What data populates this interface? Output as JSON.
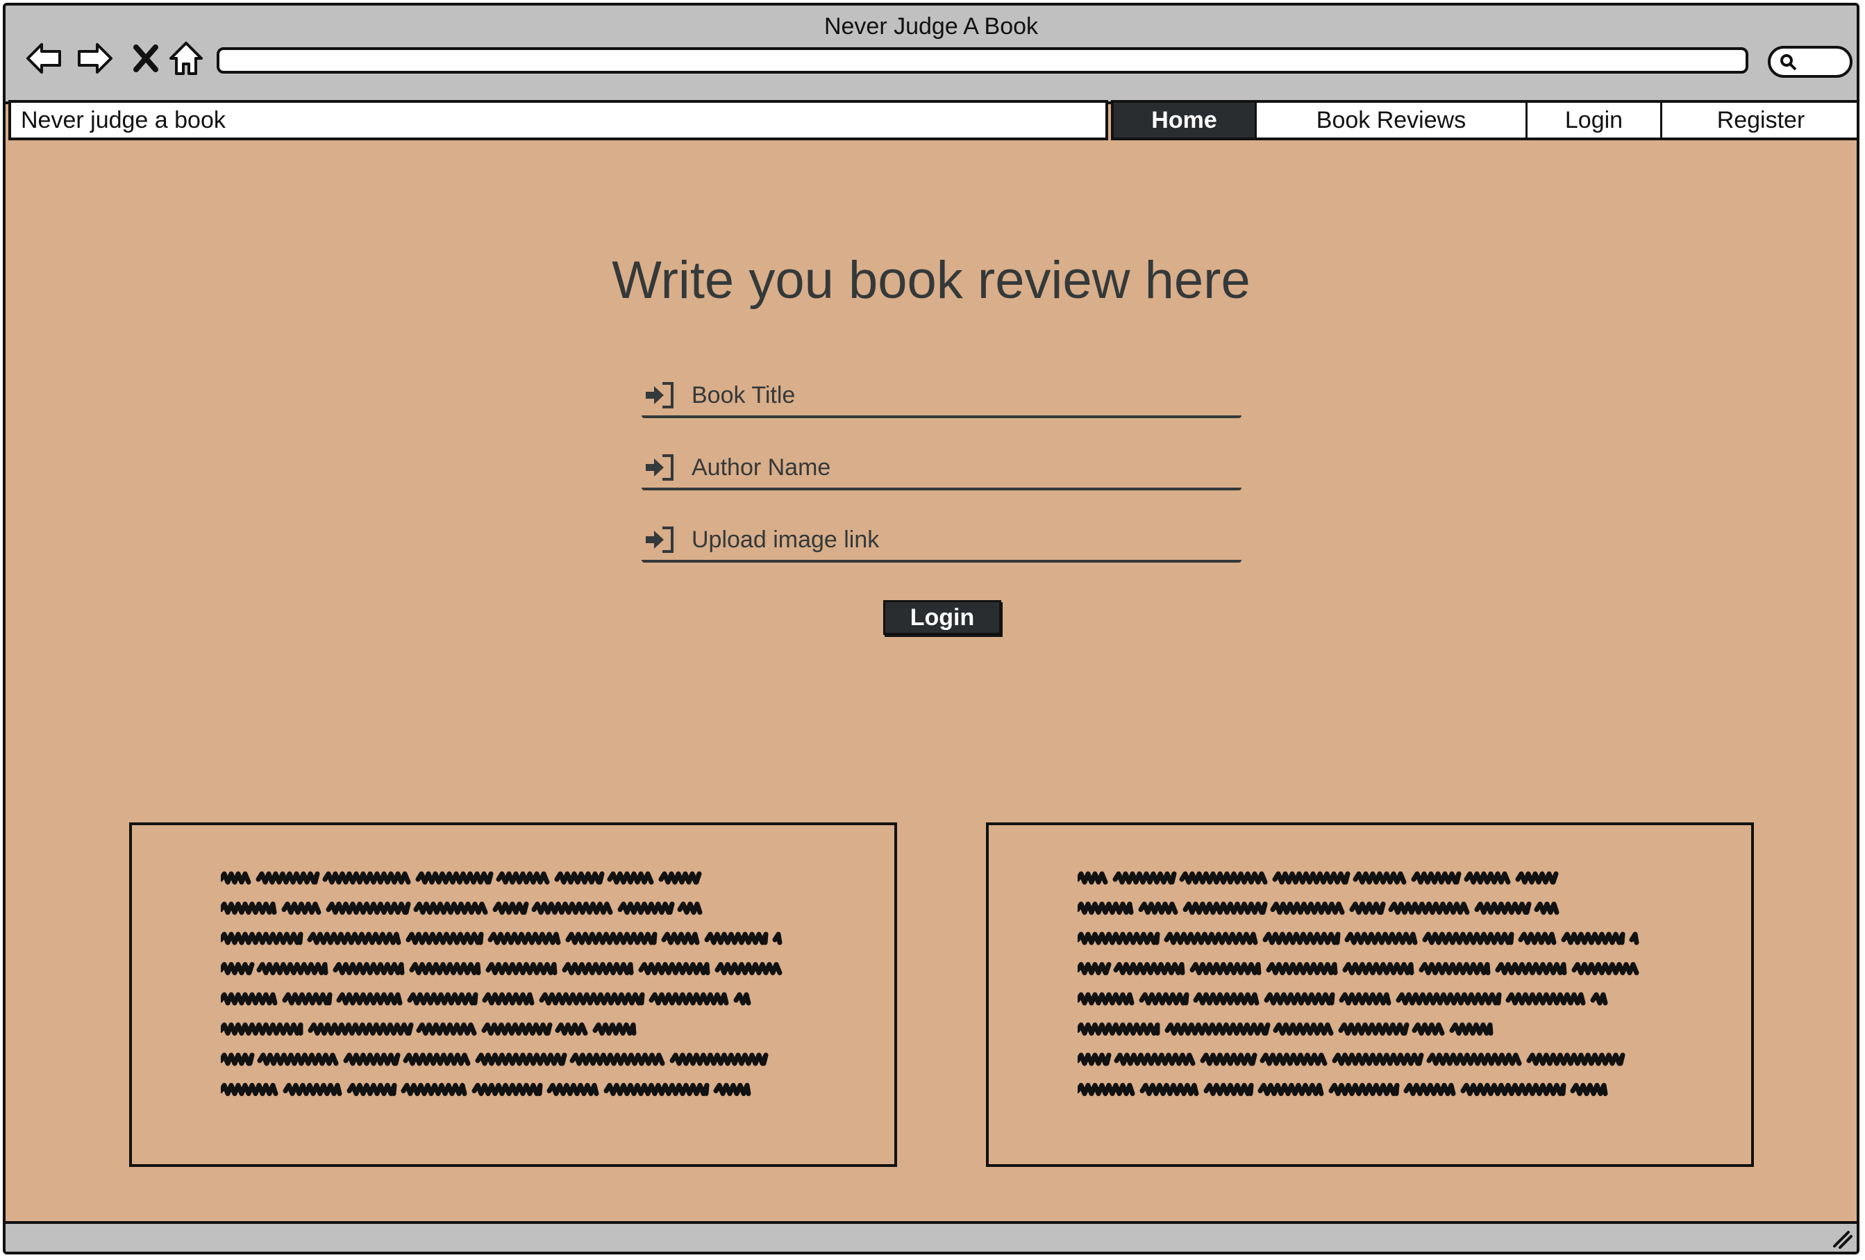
{
  "window": {
    "title": "Never Judge A Book",
    "url": ""
  },
  "browser": {
    "back_icon": "back-arrow-icon",
    "forward_icon": "forward-arrow-icon",
    "stop_icon": "close-icon",
    "home_icon": "home-icon",
    "search_icon": "search-icon"
  },
  "nav": {
    "brand": "Never judge a book",
    "tabs": [
      {
        "label": "Home",
        "active": true
      },
      {
        "label": "Book Reviews",
        "active": false
      },
      {
        "label": "Login",
        "active": false
      },
      {
        "label": "Register",
        "active": false
      }
    ]
  },
  "main": {
    "title": "Write you book review here",
    "fields": [
      {
        "placeholder": "Book Title",
        "icon": "login-arrow-icon"
      },
      {
        "placeholder": "Author Name",
        "icon": "login-arrow-icon"
      },
      {
        "placeholder": "Upload image link",
        "icon": "login-arrow-icon"
      }
    ],
    "submit_label": "Login"
  },
  "cards": [
    {
      "content": "scribbled placeholder text"
    },
    {
      "content": "scribbled placeholder text"
    }
  ],
  "colors": {
    "page_background": "#d9ae8a",
    "chrome": "#c0c0c0",
    "active_tab": "#2a2d30",
    "text": "#34393a"
  }
}
